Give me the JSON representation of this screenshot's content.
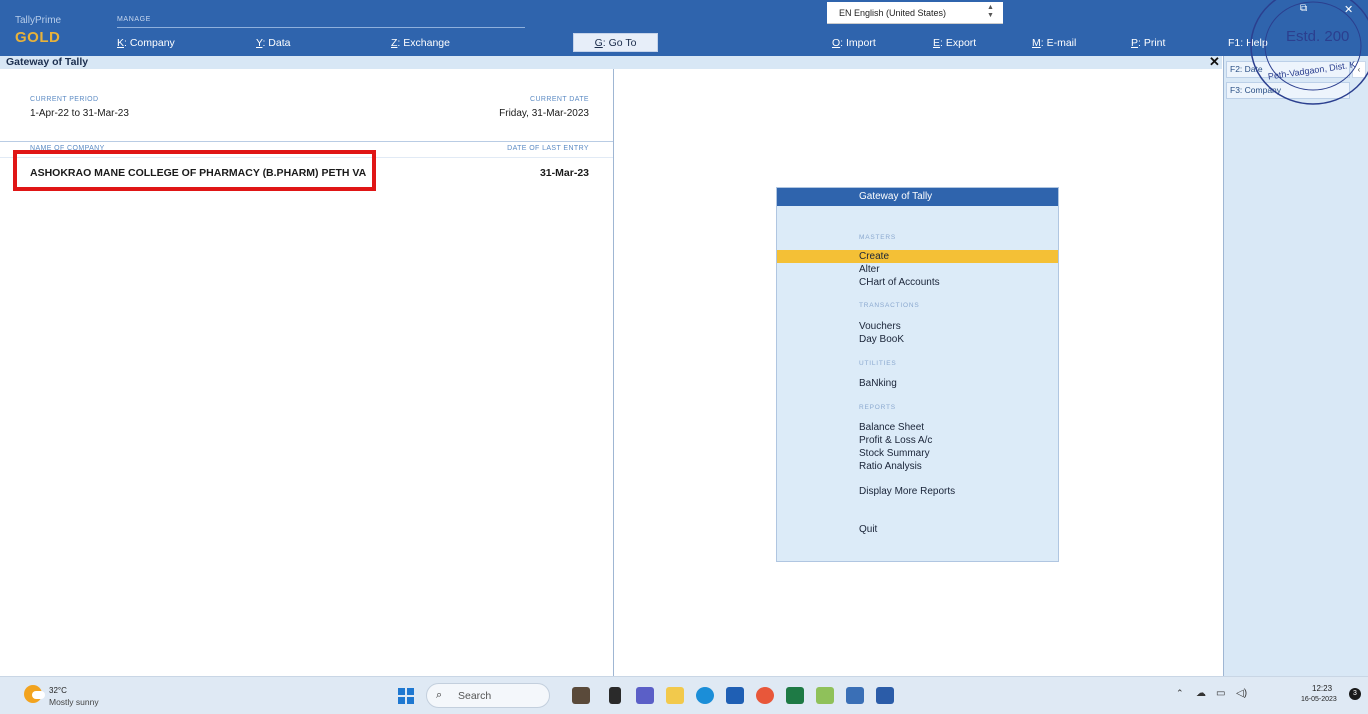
{
  "topbar": {
    "product": "TallyPrime",
    "edition": "GOLD",
    "manage_label": "MANAGE",
    "menu": [
      {
        "key": "K",
        "label": ": Company"
      },
      {
        "key": "Y",
        "label": ": Data"
      },
      {
        "key": "Z",
        "label": ": Exchange"
      },
      {
        "key": "G",
        "label": ": Go To"
      },
      {
        "key": "O",
        "label": ": Import"
      },
      {
        "key": "E",
        "label": ": Export"
      },
      {
        "key": "M",
        "label": ": E-mail"
      },
      {
        "key": "P",
        "label": ": Print"
      },
      {
        "key": "F1",
        "label": ": Help"
      }
    ],
    "language": "EN English (United States)"
  },
  "title_strip": {
    "title": "Gateway of Tally",
    "close": "✕"
  },
  "company_info": {
    "current_period_caption": "CURRENT PERIOD",
    "current_period": "1-Apr-22 to 31-Mar-23",
    "current_date_caption": "CURRENT DATE",
    "current_date": "Friday, 31-Mar-2023",
    "name_caption": "NAME OF COMPANY",
    "last_entry_caption": "DATE OF LAST ENTRY",
    "company_name": "ASHOKRAO MANE COLLEGE OF PHARMACY (B.PHARM) PETH VA",
    "last_entry": "31-Mar-23"
  },
  "gateway": {
    "header": "Gateway of Tally",
    "sections": {
      "masters": "MASTERS",
      "transactions": "TRANSACTIONS",
      "utilities": "UTILITIES",
      "reports": "REPORTS"
    },
    "items": {
      "create": "Create",
      "alter": "Alter",
      "chart_of_accounts": "CHart of Accounts",
      "vouchers": "Vouchers",
      "day_book": "Day BooK",
      "banking": "BaNking",
      "balance_sheet": "Balance Sheet",
      "profit_loss": "Profit & Loss A/c",
      "stock_summary": "Stock Summary",
      "ratio_analysis": "Ratio Analysis",
      "display_more_reports": "Display More Reports",
      "quit": "Quit"
    }
  },
  "side_buttons": {
    "f2": "F2: Date",
    "f3": "F3: Company"
  },
  "stamp": {
    "line1": "Estd. 200",
    "line2": "Peth-Vadgaon, Dist. K"
  },
  "taskbar": {
    "temperature": "32°C",
    "condition": "Mostly sunny",
    "search_placeholder": "Search",
    "time": "12:23",
    "date": "16-05-2023",
    "notification_count": "3"
  },
  "colors": {
    "topbar": "#2f64ad",
    "edition_gold": "#e8b23a",
    "selection": "#f4c036",
    "highlight_border": "#e01616"
  }
}
